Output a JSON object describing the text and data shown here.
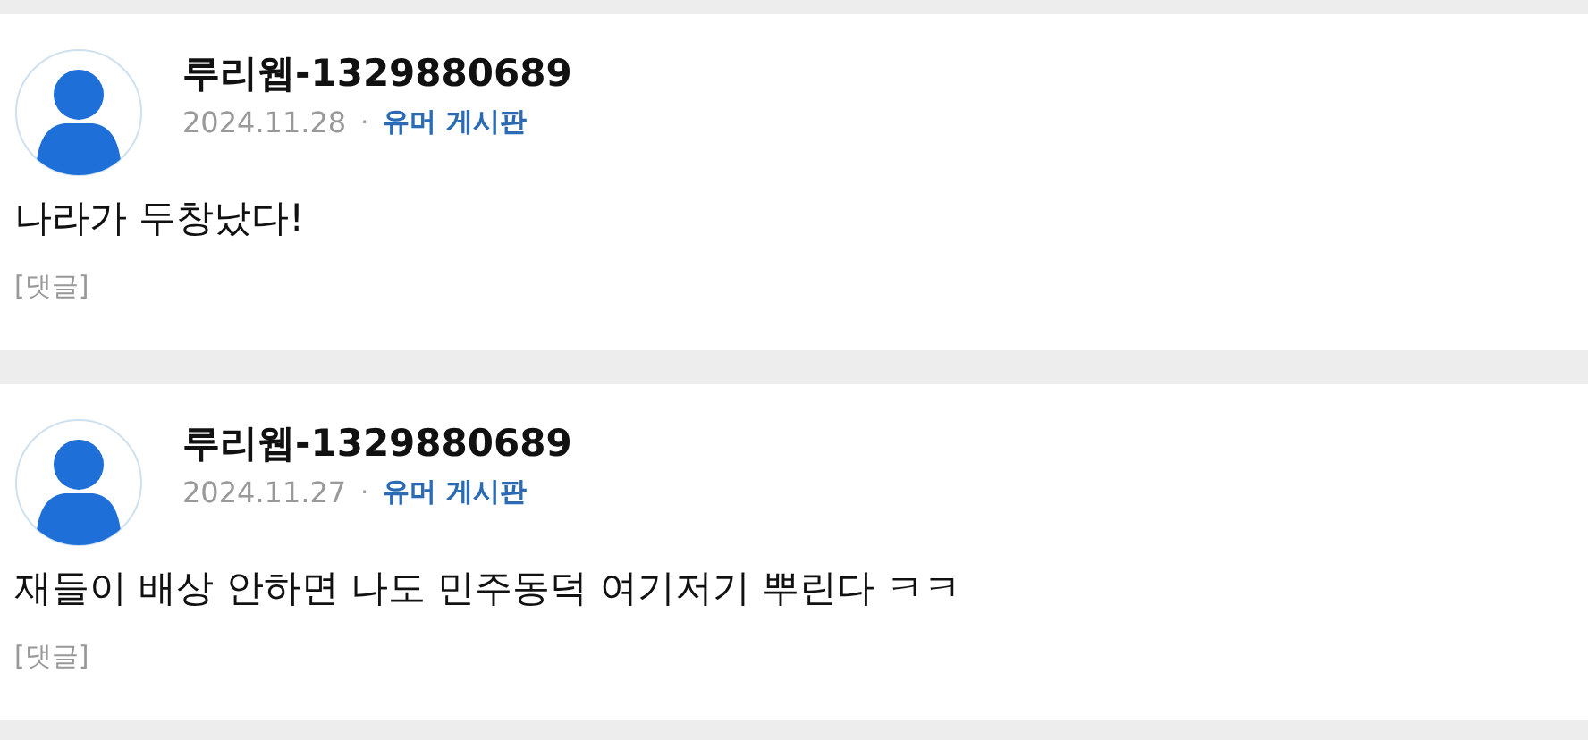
{
  "posts": [
    {
      "author": "루리웹-1329880689",
      "date": "2024.11.28",
      "separator": "·",
      "board": "유머 게시판",
      "body": "나라가 두창났다!",
      "comment_link": "[댓글]"
    },
    {
      "author": "루리웹-1329880689",
      "date": "2024.11.27",
      "separator": "·",
      "board": "유머 게시판",
      "body": "재들이 배상 안하면 나도 민주동덕 여기저기 뿌린다 ㅋㅋ",
      "comment_link": "[댓글]"
    }
  ]
}
